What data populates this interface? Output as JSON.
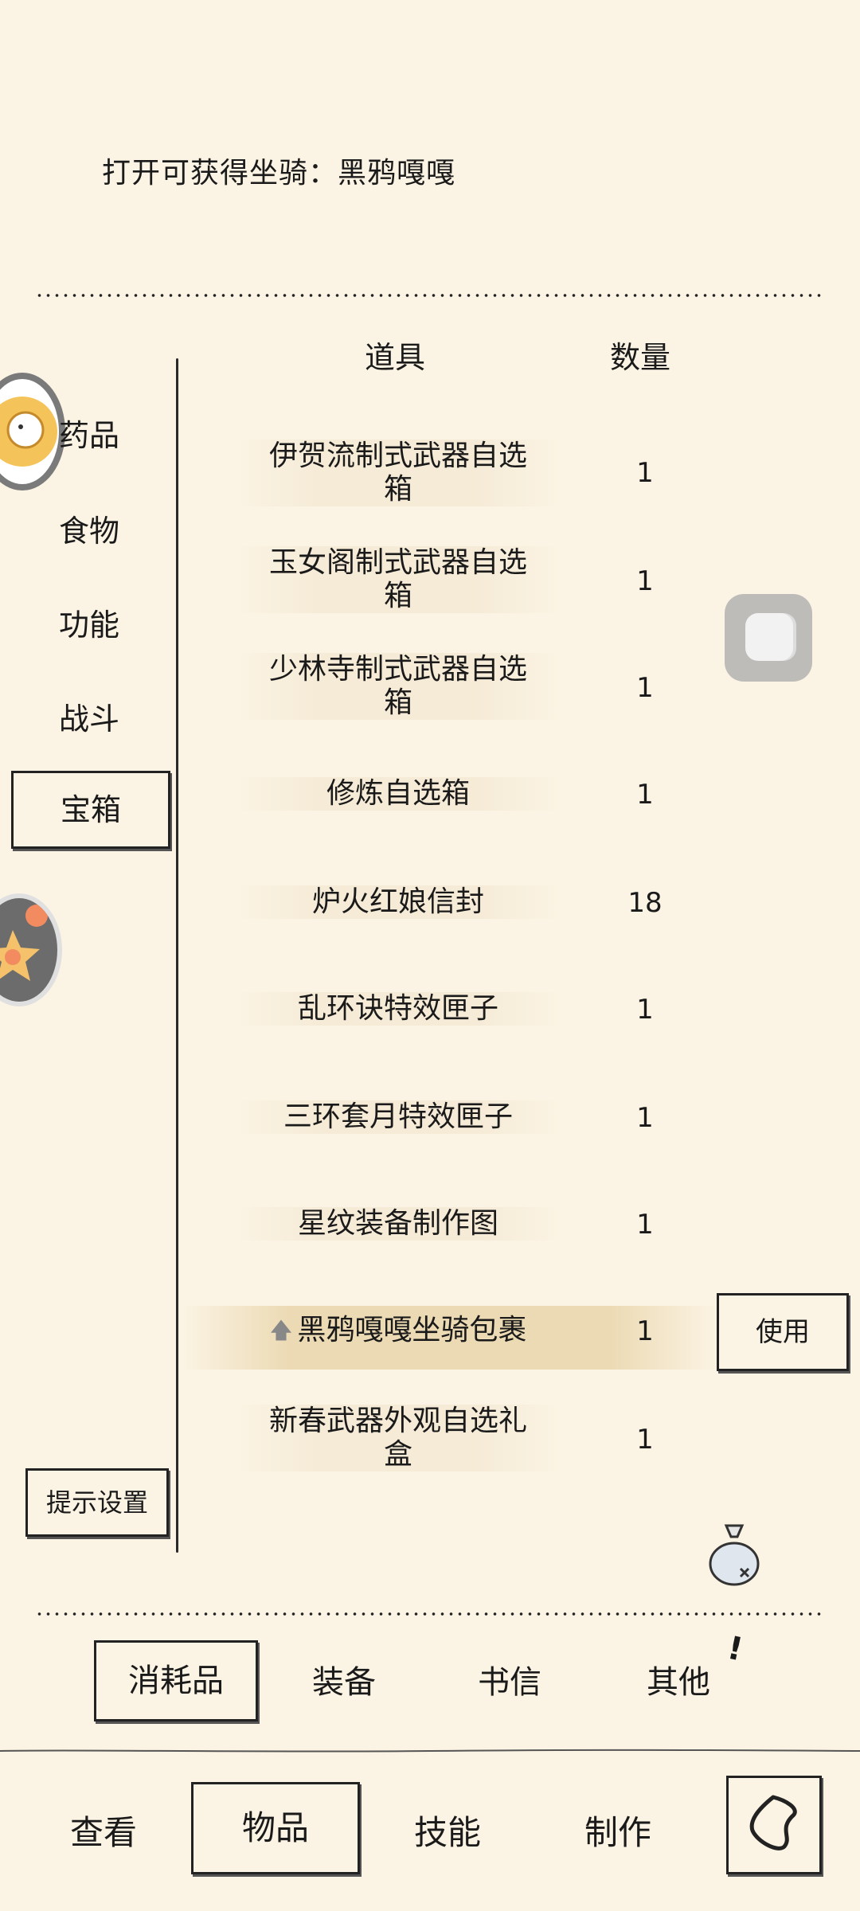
{
  "description": "打开可获得坐骑：黑鸦嘎嘎",
  "categories": [
    "药品",
    "食物",
    "功能",
    "战斗",
    "宝箱"
  ],
  "table": {
    "col_item": "道具",
    "col_qty": "数量",
    "rows": [
      {
        "name_l1": "伊贺流制式武器自选",
        "name_l2": "箱",
        "qty": "1"
      },
      {
        "name_l1": "玉女阁制式武器自选",
        "name_l2": "箱",
        "qty": "1"
      },
      {
        "name_l1": "少林寺制式武器自选",
        "name_l2": "箱",
        "qty": "1"
      },
      {
        "name_l1": "修炼自选箱",
        "qty": "1"
      },
      {
        "name_l1": "炉火红娘信封",
        "qty": "18"
      },
      {
        "name_l1": "乱环诀特效匣子",
        "qty": "1"
      },
      {
        "name_l1": "三环套月特效匣子",
        "qty": "1"
      },
      {
        "name_l1": "星纹装备制作图",
        "qty": "1"
      },
      {
        "name_l1": "黑鸦嘎嘎坐骑包裹",
        "qty": "1"
      },
      {
        "name_l1": "新春武器外观自选礼",
        "name_l2": "盒",
        "qty": "1"
      }
    ]
  },
  "use_button": "使用",
  "hint_button": "提示设置",
  "tabs": [
    "消耗品",
    "装备",
    "书信",
    "其他"
  ],
  "nav": [
    "查看",
    "物品",
    "技能",
    "制作"
  ],
  "icons": {
    "back": "back-arrow-icon",
    "float": "floating-assistant-icon",
    "bag": "bag-icon"
  }
}
